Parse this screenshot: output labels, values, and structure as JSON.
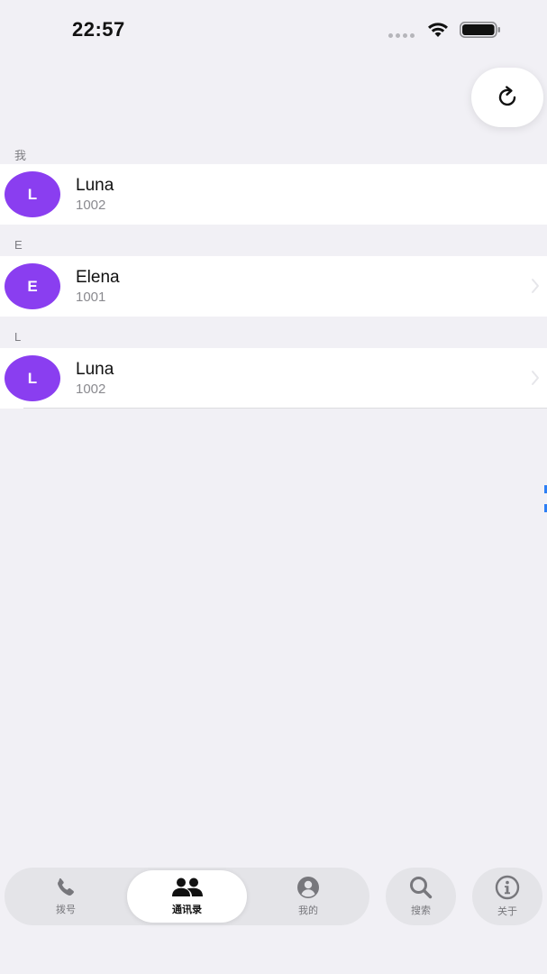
{
  "status_bar": {
    "time": "22:57"
  },
  "toolbar": {
    "refresh_icon": "refresh-icon"
  },
  "sections": [
    {
      "header": "我",
      "contacts": [
        {
          "initial": "L",
          "name": "Luna",
          "number": "1002"
        }
      ]
    },
    {
      "header": "E",
      "contacts": [
        {
          "initial": "E",
          "name": "Elena",
          "number": "1001"
        }
      ]
    },
    {
      "header": "L",
      "contacts": [
        {
          "initial": "L",
          "name": "Luna",
          "number": "1002"
        }
      ]
    }
  ],
  "tab_bar": {
    "tabs": [
      {
        "label": "拨号",
        "icon": "phone-icon",
        "active": false
      },
      {
        "label": "通讯录",
        "icon": "contacts-icon",
        "active": true
      },
      {
        "label": "我的",
        "icon": "profile-icon",
        "active": false
      },
      {
        "label": "搜索",
        "icon": "search-icon",
        "active": false
      },
      {
        "label": "关于",
        "icon": "info-icon",
        "active": false
      }
    ]
  },
  "colors": {
    "background": "#f1f0f5",
    "avatar": "#8a3ef0",
    "index_accent": "#2d7ff5"
  }
}
